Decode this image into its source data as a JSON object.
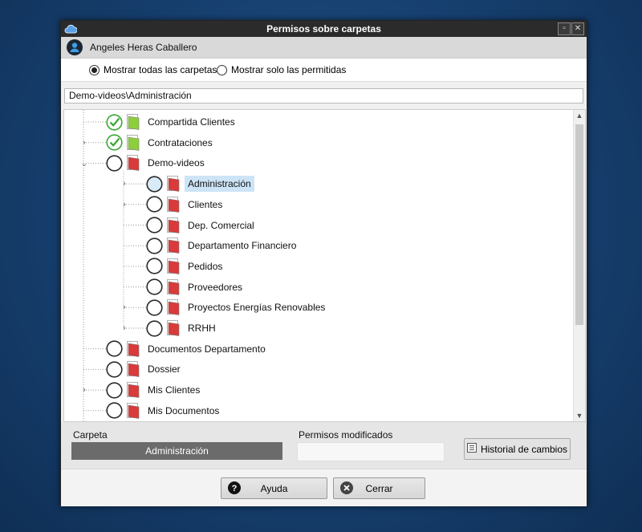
{
  "window": {
    "title": "Permisos sobre carpetas"
  },
  "user": {
    "name": "Angeles Heras Caballero"
  },
  "filter": {
    "show_all_label": "Mostrar todas las carpetas",
    "show_allowed_label": "Mostrar solo las permitidas",
    "selected": "show_all"
  },
  "path": {
    "value": "Demo-videos\\Administración"
  },
  "tree": {
    "items": [
      {
        "label": "Compartida Clientes",
        "level": 0,
        "checked": true,
        "expander": "none",
        "folder_color": "#8ccf3a"
      },
      {
        "label": "Contrataciones",
        "level": 0,
        "checked": true,
        "expander": "collapsed",
        "folder_color": "#8ccf3a"
      },
      {
        "label": "Demo-videos",
        "level": 0,
        "checked": false,
        "expander": "expanded",
        "folder_color": "#d93a3a"
      },
      {
        "label": "Administración",
        "level": 1,
        "checked": false,
        "expander": "collapsed",
        "folder_color": "#d93a3a",
        "selected": true
      },
      {
        "label": "Clientes",
        "level": 1,
        "checked": false,
        "expander": "collapsed",
        "folder_color": "#d93a3a"
      },
      {
        "label": "Dep. Comercial",
        "level": 1,
        "checked": false,
        "expander": "none",
        "folder_color": "#d93a3a"
      },
      {
        "label": "Departamento Financiero",
        "level": 1,
        "checked": false,
        "expander": "none",
        "folder_color": "#d93a3a"
      },
      {
        "label": "Pedidos",
        "level": 1,
        "checked": false,
        "expander": "none",
        "folder_color": "#d93a3a"
      },
      {
        "label": "Proveedores",
        "level": 1,
        "checked": false,
        "expander": "none",
        "folder_color": "#d93a3a"
      },
      {
        "label": "Proyectos Energías Renovables",
        "level": 1,
        "checked": false,
        "expander": "collapsed",
        "folder_color": "#d93a3a"
      },
      {
        "label": "RRHH",
        "level": 1,
        "checked": false,
        "expander": "collapsed",
        "folder_color": "#d93a3a"
      },
      {
        "label": "Documentos Departamento",
        "level": 0,
        "checked": false,
        "expander": "none",
        "folder_color": "#d93a3a"
      },
      {
        "label": "Dossier",
        "level": 0,
        "checked": false,
        "expander": "none",
        "folder_color": "#d93a3a"
      },
      {
        "label": "Mis Clientes",
        "level": 0,
        "checked": false,
        "expander": "collapsed",
        "folder_color": "#d93a3a"
      },
      {
        "label": "Mis Documentos",
        "level": 0,
        "checked": false,
        "expander": "none",
        "folder_color": "#d93a3a"
      }
    ]
  },
  "details": {
    "folder_label": "Carpeta",
    "folder_value": "Administración",
    "modified_label": "Permisos modificados",
    "modified_value": "",
    "history_button": "Historial de cambios"
  },
  "footer": {
    "help_button": "Ayuda",
    "close_button": "Cerrar"
  },
  "colors": {
    "check_green": "#3aa832",
    "selection": "#cde4f7",
    "titlebar": "#2b2b2b"
  }
}
